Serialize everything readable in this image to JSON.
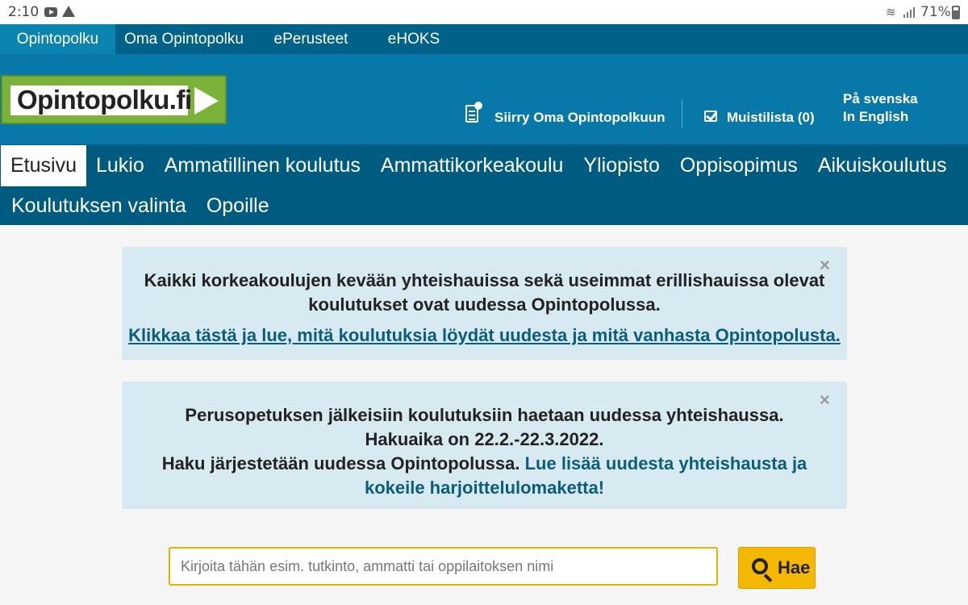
{
  "statusbar": {
    "time": "2:10",
    "battery": "71%"
  },
  "top_tabs": [
    {
      "label": "Opintopolku",
      "active": true
    },
    {
      "label": "Oma Opintopolku"
    },
    {
      "label": "ePerusteet"
    },
    {
      "label": "eHOKS"
    }
  ],
  "header": {
    "logo_text": "Opintopolku.fi",
    "oma_link": "Siirry Oma Opintopolkuun",
    "muistilista": "Muistilista (0)",
    "lang_sv": "På svenska",
    "lang_en": "In English"
  },
  "main_nav": {
    "row1": [
      "Etusivu",
      "Lukio",
      "Ammatillinen koulutus",
      "Ammattikorkeakoulu",
      "Yliopisto",
      "Oppisopimus",
      "Aikuiskoulutus"
    ],
    "row2": [
      "Koulutuksen valinta",
      "Opoille"
    ],
    "active": "Etusivu"
  },
  "alerts": {
    "close_glyph": "×",
    "first": {
      "text": "Kaikki korkeakoulujen kevään yhteishauissa sekä useimmat erillishauissa olevat koulutukset ovat uudessa Opintopolussa.",
      "link": "Klikkaa tästä ja lue, mitä koulutuksia löydät uudesta ja mitä vanhasta Opintopolusta."
    },
    "second": {
      "text1": "Perusopetuksen jälkeisiin koulutuksiin haetaan uudessa yhteishaussa. Hakuaika on 22.2.-22.3.2022.",
      "text2": "Haku järjestetään uudessa Opintopolussa.",
      "link": "Lue lisää uudesta yhteishausta ja kokeile harjoittelulomaketta!"
    }
  },
  "search": {
    "placeholder": "Kirjoita tähän esim. tutkinto, ammatti tai oppilaitoksen nimi",
    "button": "Hae"
  },
  "colors": {
    "top_tabs_bg": "#006288",
    "header_bg": "#0878a8",
    "nav_bg": "#005b80",
    "alert_bg": "#d7e9f1",
    "button_bg": "#f5b800",
    "logo_green": "#7ab23a"
  }
}
